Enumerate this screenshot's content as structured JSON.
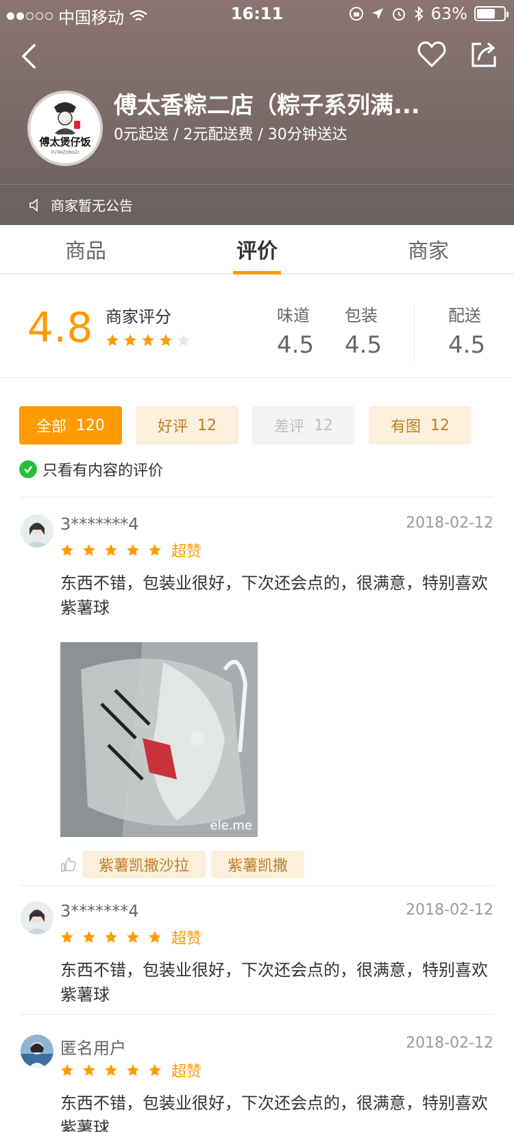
{
  "status_bar": {
    "carrier": "中国移动",
    "time": "16:11",
    "battery": "63%"
  },
  "store": {
    "logo_text": "傅太煲仔饭",
    "logo_sub": "FUTAIZONGZI",
    "name": "傅太香粽二店（粽子系列满...",
    "meta": "0元起送 / 2元配送费 / 30分钟送达",
    "notice": "商家暂无公告"
  },
  "tabs": [
    {
      "label": "商品"
    },
    {
      "label": "评价"
    },
    {
      "label": "商家"
    }
  ],
  "ratings": {
    "overall": "4.8",
    "overall_label": "商家评分",
    "overall_stars": 4,
    "taste_label": "味道",
    "taste": "4.5",
    "package_label": "包装",
    "package": "4.5",
    "delivery_label": "配送",
    "delivery": "4.5"
  },
  "filters": {
    "all": "全部",
    "all_count": "120",
    "good": "好评",
    "good_count": "12",
    "bad": "差评",
    "bad_count": "12",
    "img": "有图",
    "img_count": "12"
  },
  "only_content": "只看有内容的评价",
  "reviews": [
    {
      "name": "3*******4",
      "date": "2018-02-12",
      "tag": "超赞",
      "text": "东西不错，包装业很好，下次还会点的，很满意，特别喜欢紫薯球",
      "watermark": "ele.me",
      "dishes": [
        "紫薯凯撒沙拉",
        "紫薯凯撒"
      ],
      "stars": 5
    },
    {
      "name": "3*******4",
      "date": "2018-02-12",
      "tag": "超赞",
      "text": "东西不错，包装业很好，下次还会点的，很满意，特别喜欢紫薯球",
      "stars": 5
    },
    {
      "name": "匿名用户",
      "date": "2018-02-12",
      "tag": "超赞",
      "text": "东西不错，包装业很好，下次还会点的，很满意，特别喜欢紫薯球",
      "stars": 5
    }
  ],
  "colors": {
    "accent": "#FF9A00",
    "score": "#FF9900",
    "tag_bg": "#FCEFDB",
    "tag_text": "#B97F27",
    "divider": "#e9e9e9"
  }
}
